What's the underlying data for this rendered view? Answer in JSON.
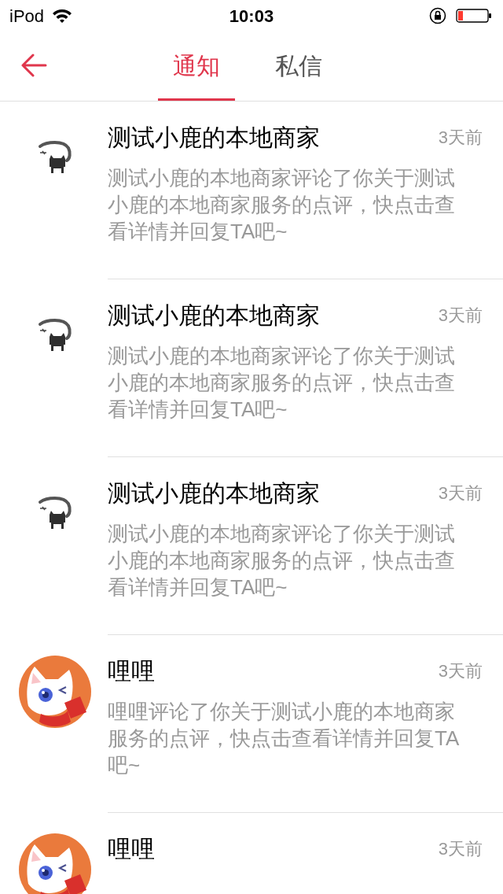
{
  "status_bar": {
    "carrier": "iPod",
    "time": "10:03"
  },
  "tabs": [
    {
      "label": "通知",
      "selected": true
    },
    {
      "label": "私信",
      "selected": false
    }
  ],
  "notifications": [
    {
      "kind": "sketch",
      "name": "测试小鹿的本地商家",
      "time": "3天前",
      "message": "测试小鹿的本地商家评论了你关于测试小鹿的本地商家服务的点评，快点击查看详情并回复TA吧~"
    },
    {
      "kind": "sketch",
      "name": "测试小鹿的本地商家",
      "time": "3天前",
      "message": "测试小鹿的本地商家评论了你关于测试小鹿的本地商家服务的点评，快点击查看详情并回复TA吧~"
    },
    {
      "kind": "sketch",
      "name": "测试小鹿的本地商家",
      "time": "3天前",
      "message": "测试小鹿的本地商家评论了你关于测试小鹿的本地商家服务的点评，快点击查看详情并回复TA吧~"
    },
    {
      "kind": "cartoon",
      "name": "哩哩",
      "time": "3天前",
      "message": "哩哩评论了你关于测试小鹿的本地商家服务的点评，快点击查看详情并回复TA吧~"
    },
    {
      "kind": "cartoon",
      "name": "哩哩",
      "time": "3天前"
    }
  ]
}
